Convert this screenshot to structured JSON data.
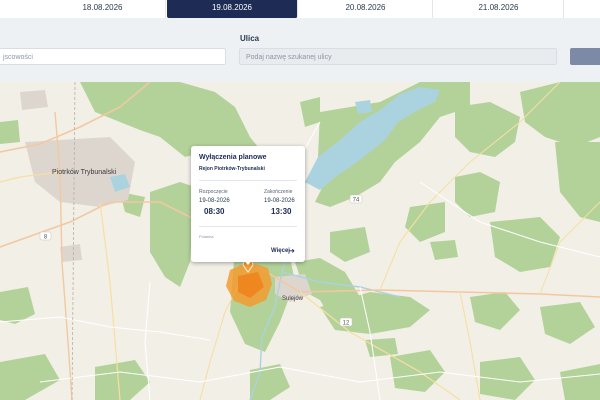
{
  "date_tabs": [
    {
      "label": "18.08.2026",
      "active": false
    },
    {
      "label": "19.08.2026",
      "active": true
    },
    {
      "label": "20.08.2026",
      "active": false
    },
    {
      "label": "21.08.2026",
      "active": false
    }
  ],
  "filters": {
    "city_value": "jscowości",
    "street_label": "Ulica",
    "street_placeholder": "Podaj nazwę szukanej ulicy"
  },
  "map": {
    "towns": [
      "Piotrków Trybunalski",
      "Sulejów"
    ],
    "route_badges": [
      "8",
      "12",
      "74"
    ]
  },
  "popup": {
    "title": "Wyłączenia planowe",
    "region": "Rejon Piotrków-Trybunalski",
    "start_label": "Rozpoczęcie",
    "start_date": "19-08-2026",
    "start_time": "08:30",
    "end_label": "Zakończenie",
    "end_date": "19-08-2026",
    "end_time": "13:30",
    "note": "Polanka",
    "more_label": "Więcej"
  },
  "colors": {
    "navy": "#1d2b55",
    "forest": "#b3d29a",
    "water": "#aad3df",
    "outage": "#f39c2f"
  }
}
